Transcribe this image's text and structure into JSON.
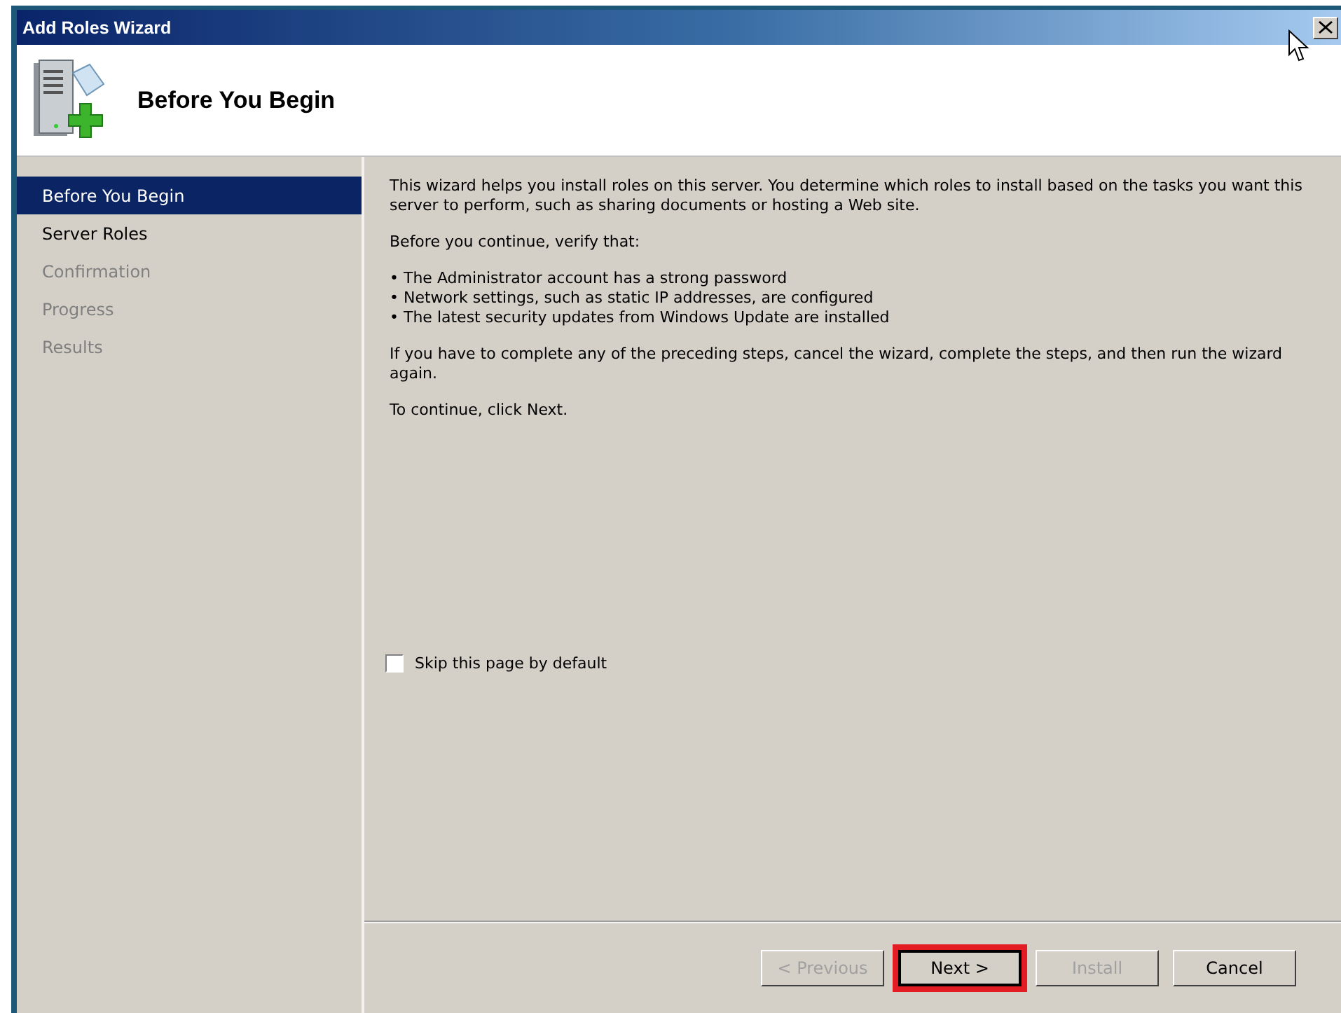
{
  "window": {
    "title": "Add Roles Wizard"
  },
  "header": {
    "title": "Before You Begin"
  },
  "sidebar": {
    "items": [
      {
        "label": "Before You Begin",
        "selected": true,
        "disabled": false
      },
      {
        "label": "Server Roles",
        "selected": false,
        "disabled": false
      },
      {
        "label": "Confirmation",
        "selected": false,
        "disabled": true
      },
      {
        "label": "Progress",
        "selected": false,
        "disabled": true
      },
      {
        "label": "Results",
        "selected": false,
        "disabled": true
      }
    ]
  },
  "content": {
    "intro": "This wizard helps you install roles on this server. You determine which roles to install based on the tasks you want this server to perform, such as sharing documents or hosting a Web site.",
    "verify_heading": "Before you continue, verify that:",
    "bullets": [
      "• The Administrator account has a strong password",
      "• Network settings, such as static IP addresses, are configured",
      "• The latest security updates from Windows Update are installed"
    ],
    "note": "If you have to complete any of the preceding steps, cancel the wizard, complete the steps, and then run the wizard again.",
    "continue": "To continue, click Next.",
    "checkbox": {
      "label": "Skip this page by default",
      "checked": false
    }
  },
  "buttons": [
    {
      "label": "< Previous",
      "disabled": true,
      "highlighted": false
    },
    {
      "label": "Next >",
      "disabled": false,
      "highlighted": true
    },
    {
      "label": "Install",
      "disabled": true,
      "highlighted": false
    },
    {
      "label": "Cancel",
      "disabled": false,
      "highlighted": false
    }
  ]
}
